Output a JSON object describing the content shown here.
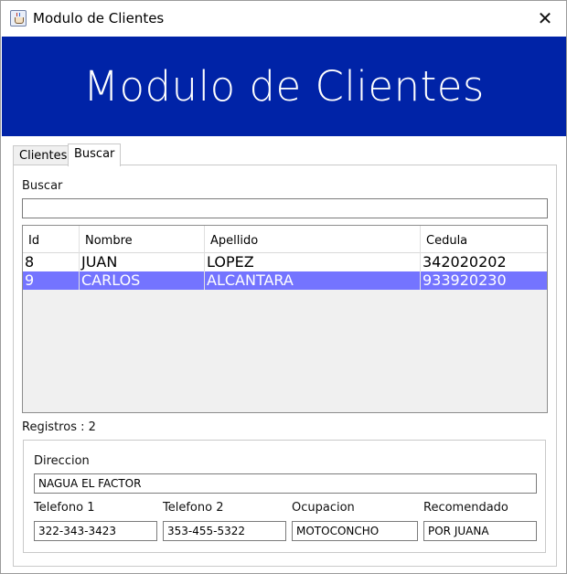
{
  "window": {
    "title": "Modulo de Clientes"
  },
  "banner": {
    "title": "Modulo de Clientes"
  },
  "tabs": [
    {
      "label": "Clientes"
    },
    {
      "label": "Buscar"
    }
  ],
  "search": {
    "label": "Buscar",
    "value": ""
  },
  "table": {
    "columns": [
      "Id",
      "Nombre",
      "Apellido",
      "Cedula"
    ],
    "rows": [
      {
        "id": "8",
        "nombre": "JUAN",
        "apellido": "LOPEZ",
        "cedula": "342020202",
        "selected": false
      },
      {
        "id": "9",
        "nombre": "CARLOS",
        "apellido": "ALCANTARA",
        "cedula": "933920230",
        "selected": true
      }
    ]
  },
  "registros": {
    "text": "Registros : 2"
  },
  "details": {
    "direccion": {
      "label": "Direccion",
      "value": "NAGUA EL FACTOR"
    },
    "telefono1": {
      "label": "Telefono 1",
      "value": "322-343-3423"
    },
    "telefono2": {
      "label": "Telefono 2",
      "value": "353-455-5322"
    },
    "ocupacion": {
      "label": "Ocupacion",
      "value": "MOTOCONCHO"
    },
    "recomendado": {
      "label": "Recomendado",
      "value": "POR JUANA"
    }
  },
  "colors": {
    "banner": "#0023a7",
    "selection": "#7474ff"
  }
}
